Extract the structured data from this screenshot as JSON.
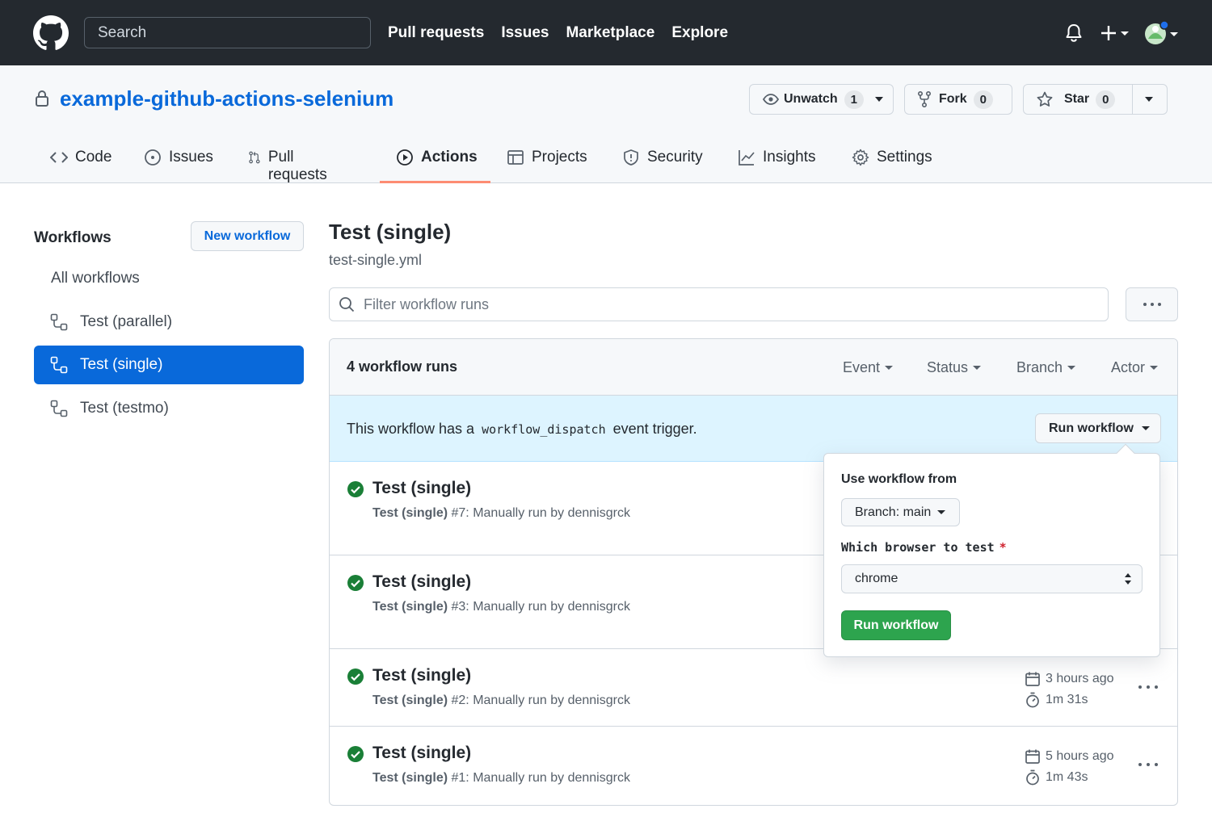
{
  "header": {
    "search_placeholder": "Search",
    "nav": [
      "Pull requests",
      "Issues",
      "Marketplace",
      "Explore"
    ]
  },
  "repo": {
    "name": "example-github-actions-selenium",
    "watch": {
      "label": "Unwatch",
      "count": "1"
    },
    "fork": {
      "label": "Fork",
      "count": "0"
    },
    "star": {
      "label": "Star",
      "count": "0"
    },
    "tabs": {
      "code": "Code",
      "issues": "Issues",
      "pulls": "Pull requests",
      "actions": "Actions",
      "projects": "Projects",
      "security": "Security",
      "insights": "Insights",
      "settings": "Settings"
    }
  },
  "sidebar": {
    "title": "Workflows",
    "new_workflow": "New workflow",
    "all": "All workflows",
    "items": [
      "Test (parallel)",
      "Test (single)",
      "Test (testmo)"
    ]
  },
  "main": {
    "title": "Test (single)",
    "file": "test-single.yml",
    "filter_placeholder": "Filter workflow runs",
    "runs_count": "4 workflow runs",
    "filters": [
      "Event",
      "Status",
      "Branch",
      "Actor"
    ],
    "dispatch": {
      "before": "This workflow has a",
      "code": "workflow_dispatch",
      "after": "event trigger.",
      "button": "Run workflow"
    },
    "runs": [
      {
        "title": "Test (single)",
        "name": "Test (single)",
        "detail": "#7: Manually run by dennisgrck",
        "time": "",
        "duration": ""
      },
      {
        "title": "Test (single)",
        "name": "Test (single)",
        "detail": "#3: Manually run by dennisgrck",
        "time": "",
        "duration": ""
      },
      {
        "title": "Test (single)",
        "name": "Test (single)",
        "detail": "#2: Manually run by dennisgrck",
        "time": "3 hours ago",
        "duration": "1m 31s"
      },
      {
        "title": "Test (single)",
        "name": "Test (single)",
        "detail": "#1: Manually run by dennisgrck",
        "time": "5 hours ago",
        "duration": "1m 43s"
      }
    ]
  },
  "popover": {
    "label": "Use workflow from",
    "branch": "Branch: main",
    "input_label": "Which browser to test",
    "required_mark": "*",
    "select_value": "chrome",
    "submit": "Run workflow"
  },
  "colors": {
    "header_bg": "#24292f",
    "link": "#0969da",
    "active_tab_underline": "#fd8c73",
    "success": "#1a7f37",
    "run_button": "#2da44e",
    "dispatch_bg": "#ddf4ff"
  }
}
